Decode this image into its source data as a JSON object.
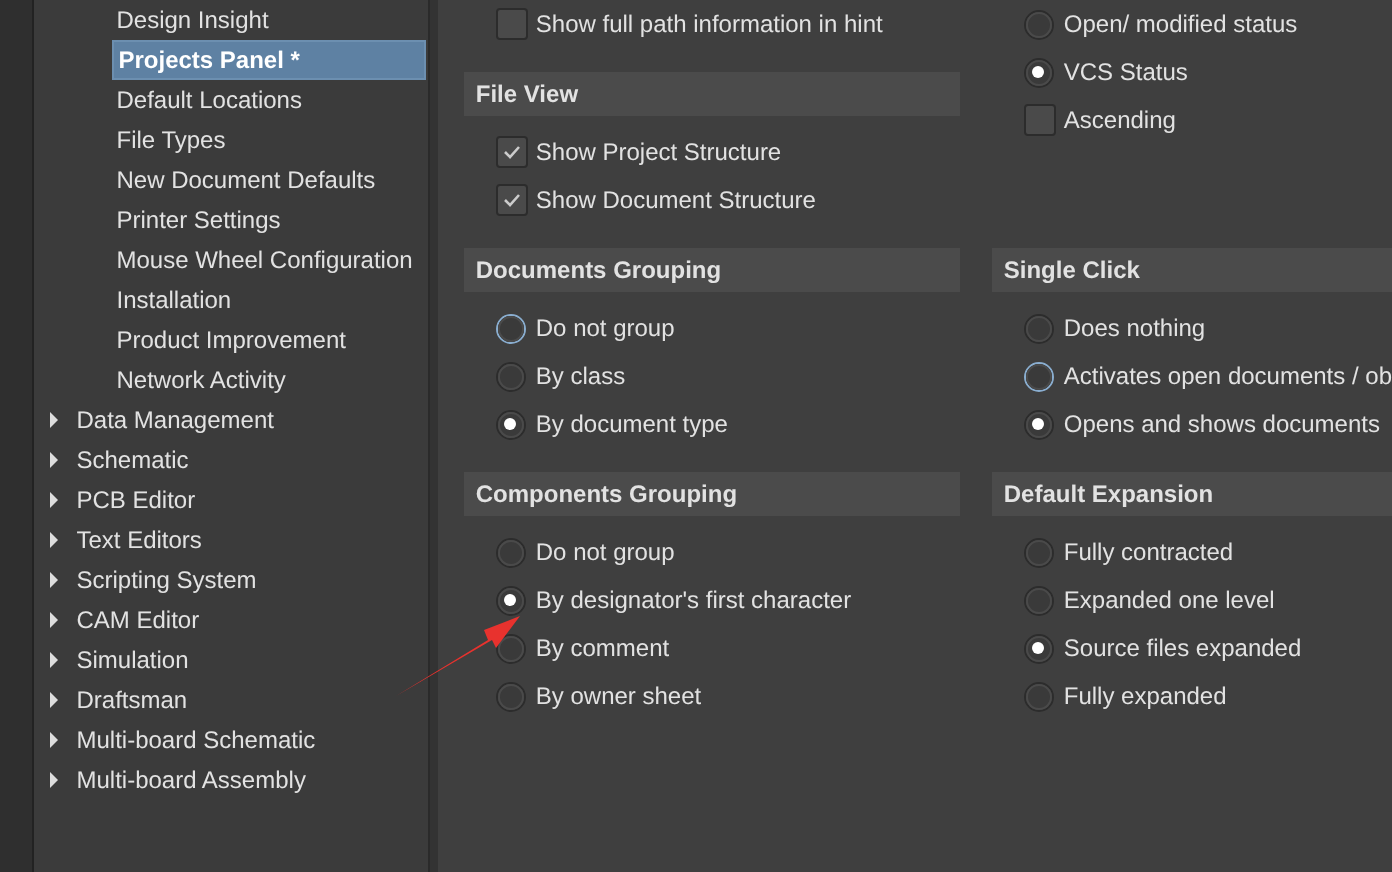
{
  "sidebar": {
    "children": [
      {
        "label": "Design Insight",
        "selected": false
      },
      {
        "label": "Projects Panel *",
        "selected": true
      },
      {
        "label": "Default Locations",
        "selected": false
      },
      {
        "label": "File Types",
        "selected": false
      },
      {
        "label": "New Document Defaults",
        "selected": false
      },
      {
        "label": "Printer Settings",
        "selected": false
      },
      {
        "label": "Mouse Wheel Configuration",
        "selected": false
      },
      {
        "label": "Installation",
        "selected": false
      },
      {
        "label": "Product Improvement",
        "selected": false
      },
      {
        "label": "Network Activity",
        "selected": false
      }
    ],
    "items": [
      {
        "label": "Data Management",
        "expanded": false
      },
      {
        "label": "Schematic",
        "expanded": false
      },
      {
        "label": "PCB Editor",
        "expanded": false
      },
      {
        "label": "Text Editors",
        "expanded": false
      },
      {
        "label": "Scripting System",
        "expanded": false
      },
      {
        "label": "CAM Editor",
        "expanded": false
      },
      {
        "label": "Simulation",
        "expanded": false
      },
      {
        "label": "Draftsman",
        "expanded": false
      },
      {
        "label": "Multi-board Schematic",
        "expanded": false
      },
      {
        "label": "Multi-board Assembly",
        "expanded": false
      }
    ]
  },
  "rows": [
    [
      [
        {
          "options": [
            {
              "kind": "checkbox",
              "label": "Show full path information in hint",
              "checked": false
            }
          ]
        },
        {
          "title": "File View",
          "options": [
            {
              "kind": "checkbox",
              "label": "Show Project Structure",
              "checked": true
            },
            {
              "kind": "checkbox",
              "label": "Show Document Structure",
              "checked": true
            }
          ]
        }
      ],
      [
        {
          "options": [
            {
              "kind": "radio",
              "label": "Open/ modified status",
              "selected": false,
              "focused": false
            },
            {
              "kind": "radio",
              "label": "VCS Status",
              "selected": true,
              "focused": false
            },
            {
              "kind": "checkbox",
              "label": "Ascending",
              "checked": false
            }
          ]
        }
      ]
    ],
    [
      [
        {
          "title": "Documents Grouping",
          "options": [
            {
              "kind": "radio",
              "label": "Do not group",
              "selected": false,
              "focused": true
            },
            {
              "kind": "radio",
              "label": "By class",
              "selected": false,
              "focused": false
            },
            {
              "kind": "radio",
              "label": "By document type",
              "selected": true,
              "focused": false
            }
          ]
        }
      ],
      [
        {
          "title": "Single Click",
          "options": [
            {
              "kind": "radio",
              "label": "Does nothing",
              "selected": false,
              "focused": false
            },
            {
              "kind": "radio",
              "label": "Activates open documents / ob",
              "selected": false,
              "focused": true
            },
            {
              "kind": "radio",
              "label": "Opens and shows documents",
              "selected": true,
              "focused": false
            }
          ]
        }
      ]
    ],
    [
      [
        {
          "title": "Components Grouping",
          "options": [
            {
              "kind": "radio",
              "label": "Do not group",
              "selected": false,
              "focused": false
            },
            {
              "kind": "radio",
              "label": "By designator's first character",
              "selected": true,
              "focused": false
            },
            {
              "kind": "radio",
              "label": "By comment",
              "selected": false,
              "focused": false
            },
            {
              "kind": "radio",
              "label": "By owner sheet",
              "selected": false,
              "focused": false
            }
          ]
        }
      ],
      [
        {
          "title": "Default Expansion",
          "options": [
            {
              "kind": "radio",
              "label": "Fully contracted",
              "selected": false,
              "focused": false
            },
            {
              "kind": "radio",
              "label": "Expanded one level",
              "selected": false,
              "focused": false
            },
            {
              "kind": "radio",
              "label": "Source files expanded",
              "selected": true,
              "focused": false
            },
            {
              "kind": "radio",
              "label": "Fully expanded",
              "selected": false,
              "focused": false
            }
          ]
        }
      ]
    ]
  ]
}
